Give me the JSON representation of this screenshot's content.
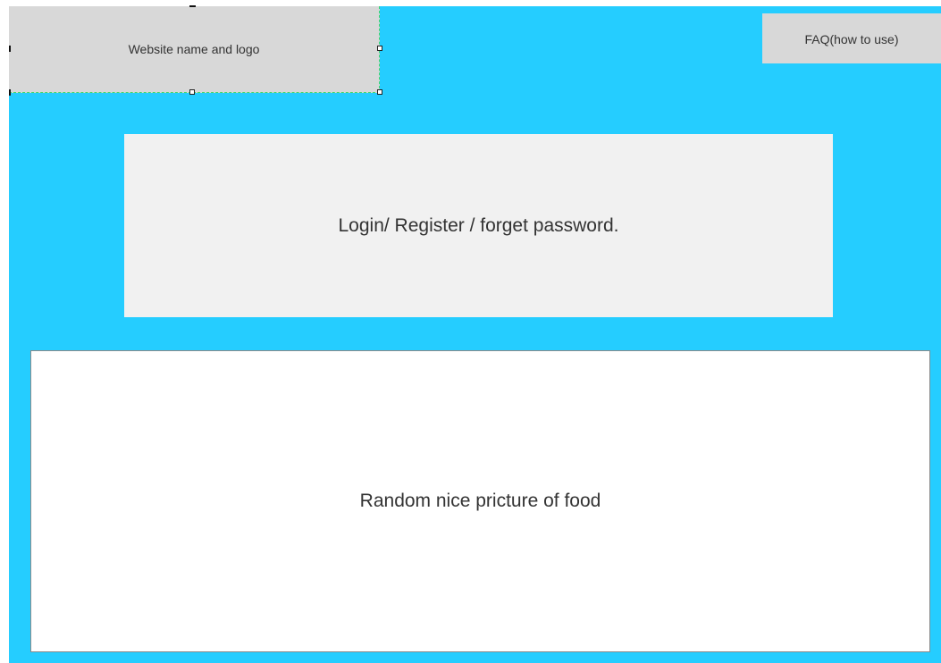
{
  "header": {
    "logo_text": "Website name and logo",
    "faq_label": "FAQ(how to use)"
  },
  "main": {
    "login_text": "Login/ Register / forget password.",
    "picture_text": "Random nice pricture of food"
  },
  "colors": {
    "background": "#25cdff",
    "box_gray": "#d8d8d8",
    "login_bg": "#f1f1f1",
    "picture_bg": "#ffffff"
  }
}
